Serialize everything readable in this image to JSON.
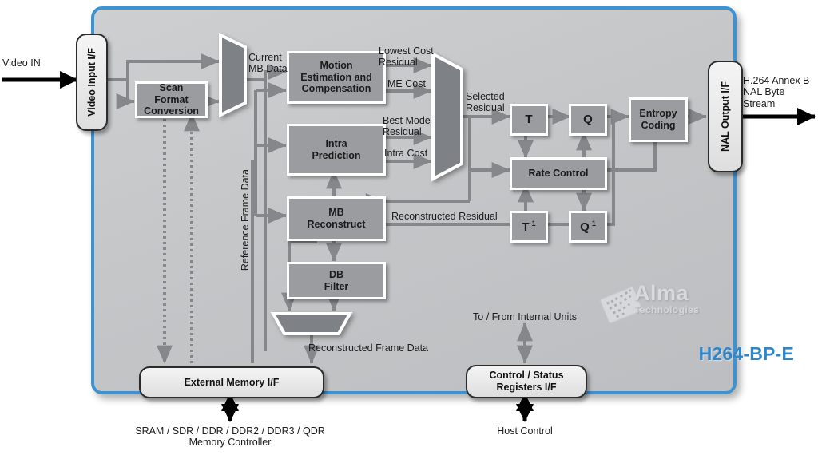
{
  "diagram": {
    "title": "H264-BP-E",
    "vendor": {
      "name": "Alma",
      "tagline": "Technologies"
    }
  },
  "interfaces": [
    {
      "id": "video-input",
      "label": "Video Input I/F"
    },
    {
      "id": "nal-output",
      "label": "NAL Output I/F"
    },
    {
      "id": "external-memory",
      "label": "External Memory I/F"
    },
    {
      "id": "control-status",
      "label": "Control / Status\nRegisters I/F"
    }
  ],
  "blocks": [
    {
      "id": "scan-format-conversion",
      "label": "Scan\nFormat\nConversion"
    },
    {
      "id": "motion-estimation",
      "label": "Motion\nEstimation and\nCompensation"
    },
    {
      "id": "intra-prediction",
      "label": "Intra\nPrediction"
    },
    {
      "id": "mb-reconstruct",
      "label": "MB\nReconstruct"
    },
    {
      "id": "db-filter",
      "label": "DB\nFilter"
    },
    {
      "id": "transform",
      "label": "T"
    },
    {
      "id": "quantization",
      "label": "Q"
    },
    {
      "id": "inverse-transform",
      "label": "T-1"
    },
    {
      "id": "inverse-quantization",
      "label": "Q-1"
    },
    {
      "id": "rate-control",
      "label": "Rate Control"
    },
    {
      "id": "entropy-coding",
      "label": "Entropy\nCoding"
    }
  ],
  "signals": {
    "video_in": "Video IN",
    "current_mb_data": "Current\nMB Data",
    "lowest_cost_residual": "Lowest Cost\nResidual",
    "me_cost": "ME Cost",
    "best_mode_residual": "Best Mode\nResidual",
    "intra_cost": "Intra Cost",
    "selected_residual": "Selected\nResidual",
    "reconstructed_residual": "Reconstructed Residual",
    "reference_frame_data": "Reference Frame Data",
    "reconstructed_frame_data": "Reconstructed Frame Data",
    "nal_byte_stream": "H.264 Annex B\nNAL Byte\nStream",
    "to_from_internal_units": "To / From Internal Units",
    "memory_controller": "SRAM / SDR / DDR / DDR2 / DDR3 / QDR\nMemory Controller",
    "host_control": "Host Control"
  },
  "colors": {
    "frame_border": "#3f92d2",
    "frame_fill": "#c6c8ca",
    "block_fill": "#9a9c9f",
    "wire": "#85878a",
    "external_wire": "#000000",
    "title": "#2f86c8"
  }
}
